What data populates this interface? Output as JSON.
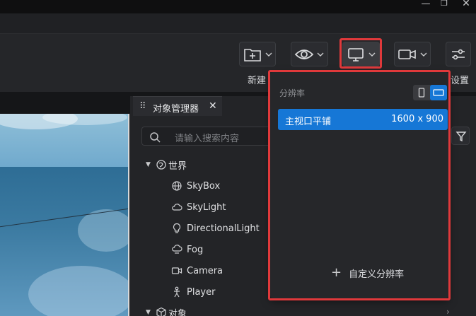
{
  "window": {
    "minimize_icon": "minimize-icon",
    "maximize_icon": "restore-icon",
    "close_icon": "close-icon"
  },
  "toolbar": {
    "buttons": [
      {
        "name": "new",
        "icon": "folder-plus-icon"
      },
      {
        "name": "view",
        "icon": "eye-icon"
      },
      {
        "name": "display",
        "icon": "monitor-icon"
      },
      {
        "name": "camera",
        "icon": "video-camera-icon"
      },
      {
        "name": "settings",
        "icon": "sliders-icon"
      }
    ],
    "new_label": "新建",
    "settings_label": "设置"
  },
  "object_manager": {
    "tab_title": "对象管理器",
    "tab_close": "✕",
    "search_placeholder": "请输入搜索内容",
    "tree": {
      "world_label": "世界",
      "children": [
        {
          "label": "SkyBox",
          "icon": "globe-icon"
        },
        {
          "label": "SkyLight",
          "icon": "cloud-icon"
        },
        {
          "label": "DirectionalLight",
          "icon": "bulb-icon"
        },
        {
          "label": "Fog",
          "icon": "fog-icon"
        },
        {
          "label": "Camera",
          "icon": "camera-icon"
        },
        {
          "label": "Player",
          "icon": "player-icon"
        }
      ],
      "objects_label": "对象"
    }
  },
  "resolution_popup": {
    "title": "分辨率",
    "selected": {
      "name": "主视口平铺",
      "size": "1600 x 900"
    },
    "custom_label": "自定义分辨率"
  },
  "colors": {
    "accent": "#1677d6",
    "highlight": "#e0393b"
  }
}
